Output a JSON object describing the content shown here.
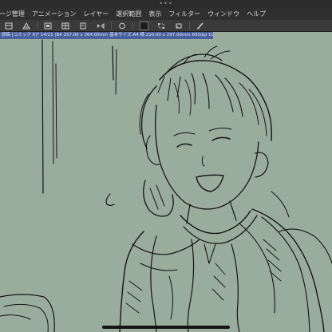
{
  "window": {
    "more_dots": "•••"
  },
  "menubar": {
    "items": [
      "ージ管理",
      "アニメーション",
      "レイヤー",
      "選択範囲",
      "表示",
      "フィルター",
      "ウィンドウ",
      "ヘルプ"
    ]
  },
  "toolbar": {
    "tools": [
      "layer-settings-icon",
      "paper-icon",
      "frame-icon",
      "export-icon",
      "copy-icon",
      "flip-icon",
      "circle-icon",
      "color-swatch",
      "transform-icon",
      "select-icon",
      "pen-icon"
    ],
    "swatch_color": "#1b1b1b"
  },
  "document": {
    "info": "原稿 [コミック 6]* 14/21 (B4 257.00 x 364.00mm 基本サイズ:A4 横 210.00 x 297.00mm 600dpi 105.5%)"
  },
  "canvas": {
    "background": "#9aac9c",
    "subject": "sketch of a smiling person with messy hair wearing a jacket"
  }
}
